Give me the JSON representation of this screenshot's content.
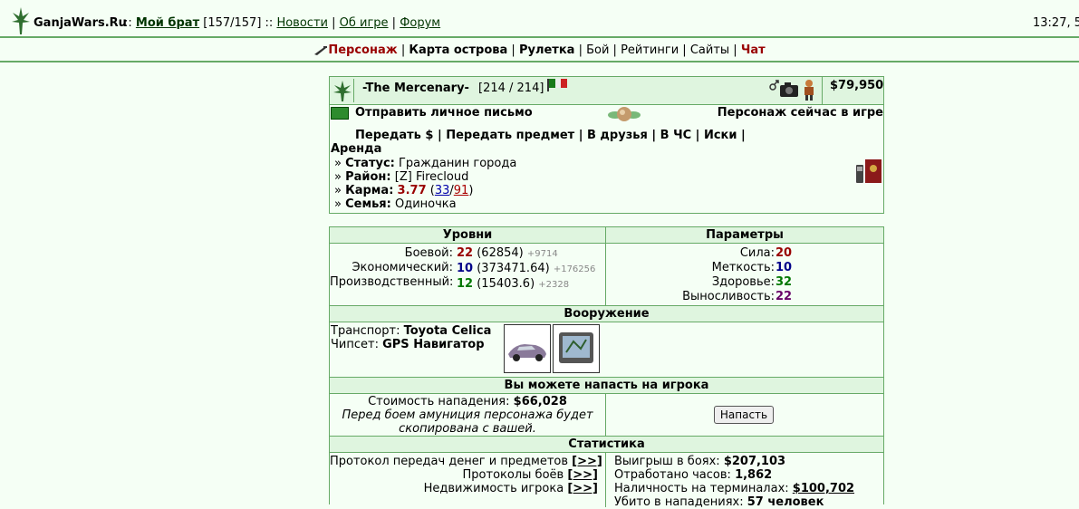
{
  "header": {
    "site": "GanjaWars.Ru",
    "sep1": "::",
    "my_brother": "Мой брат",
    "hp": "[157/157]",
    "sep2": "::",
    "news": "Новости",
    "about": "Об игре",
    "forum": "Форум",
    "clock": "13:27, 5"
  },
  "nav": [
    {
      "label": "Персонаж",
      "style": "red"
    },
    {
      "label": "Карта острова",
      "style": "b"
    },
    {
      "label": "Рулетка",
      "style": "b"
    },
    {
      "label": "Бой",
      "style": ""
    },
    {
      "label": "Рейтинги",
      "style": ""
    },
    {
      "label": "Сайты",
      "style": ""
    },
    {
      "label": "Чат",
      "style": "red"
    }
  ],
  "player": {
    "name": "-The Mercenary-",
    "hp": "[214 / 214]",
    "money": "$79,950",
    "send_mail": "Отправить личное письмо",
    "online": "Персонаж сейчас в игре",
    "actions": [
      "Передать $",
      "Передать предмет",
      "В друзья",
      "В ЧС",
      "Иски"
    ],
    "rent": "Аренда",
    "status_label": "Статус:",
    "status": "Гражданин города",
    "district_label": "Район:",
    "district": "[Z] Firecloud",
    "karma_label": "Карма:",
    "karma": "3.77",
    "karma_plus": "33",
    "karma_minus": "91",
    "family_label": "Семья:",
    "family": "Одиночка"
  },
  "levels": {
    "title": "Уровни",
    "rows": [
      {
        "label": "Боевой:",
        "value": "22",
        "exp": "(62854)",
        "delta": "+9714",
        "color": "v-red"
      },
      {
        "label": "Экономический:",
        "value": "10",
        "exp": "(373471.64)",
        "delta": "+176256",
        "color": "v-blue"
      },
      {
        "label": "Производственный:",
        "value": "12",
        "exp": "(15403.6)",
        "delta": "+2328",
        "color": "v-green"
      }
    ]
  },
  "params": {
    "title": "Параметры",
    "rows": [
      {
        "label": "Сила:",
        "value": "20",
        "color": "v-red"
      },
      {
        "label": "Меткость:",
        "value": "10",
        "color": "v-blue"
      },
      {
        "label": "Здоровье:",
        "value": "32",
        "color": "v-green"
      },
      {
        "label": "Выносливость:",
        "value": "22",
        "color": "v-purple"
      }
    ]
  },
  "weapons": {
    "title": "Вооружение",
    "transport_label": "Транспорт:",
    "transport": "Toyota Celica",
    "chip_label": "Чипсет:",
    "chip": "GPS Навигатор"
  },
  "attack": {
    "title": "Вы можете напасть на игрока",
    "cost_label": "Стоимость нападения:",
    "cost": "$66,028",
    "note1": "Перед боем амуниция персонажа будет",
    "note2": "скопирована с вашей.",
    "button": "Напасть"
  },
  "statistics": {
    "title": "Статистика",
    "left": [
      {
        "label": "Протокол передач денег и предметов",
        "link": "[>>]"
      },
      {
        "label": "Протоколы боёв",
        "link": "[>>]"
      },
      {
        "label": "Недвижимость игрока",
        "link": "[>>]"
      }
    ],
    "right": [
      {
        "label": "Выигрыш в боях:",
        "value": "$207,103"
      },
      {
        "label": "Отработано часов:",
        "value": "1,862"
      },
      {
        "label": "Наличность на терминалах:",
        "value": "$100,702"
      },
      {
        "label": "Убито в нападениях:",
        "value": "57 человек"
      }
    ]
  }
}
